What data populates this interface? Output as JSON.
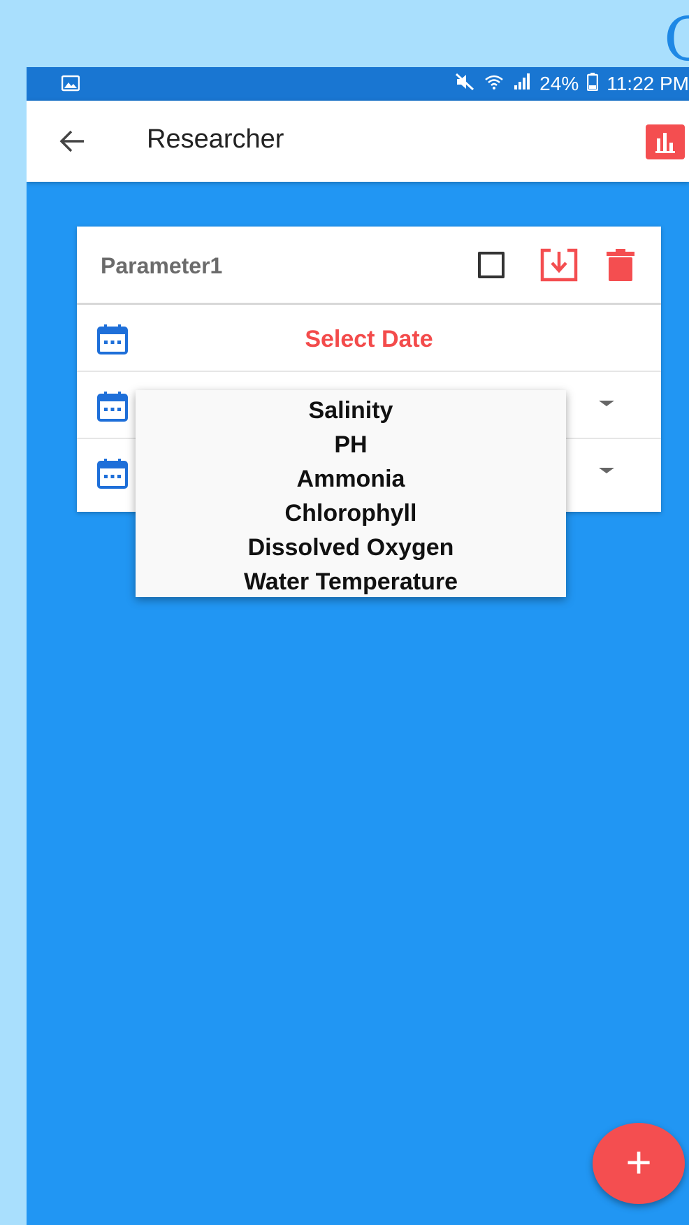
{
  "status_bar": {
    "battery_percent": "24%",
    "time": "11:22 PM",
    "icons": [
      "gallery-icon",
      "mute-icon",
      "wifi-icon",
      "signal-icon",
      "battery-icon"
    ]
  },
  "app_bar": {
    "title": "Researcher",
    "back_icon": "arrow-left-icon",
    "action_icon": "bar-chart-icon"
  },
  "card": {
    "title": "Parameter1",
    "header_icons": [
      "checkbox-icon",
      "download-icon",
      "delete-icon"
    ],
    "rows": [
      {
        "icon": "calendar-icon",
        "label": "Select Date"
      },
      {
        "icon": "calendar-icon",
        "label": ""
      },
      {
        "icon": "calendar-icon",
        "label": ""
      }
    ]
  },
  "dropdown": {
    "options": [
      "Salinity",
      "PH",
      "Ammonia",
      "Chlorophyll",
      "Dissolved Oxygen",
      "Water Temperature"
    ]
  },
  "fab": {
    "label": "+",
    "icon": "plus-icon"
  },
  "colors": {
    "page_background": "#a9dffd",
    "status_bar": "#1976d2",
    "app_background": "#2196f3",
    "accent_red": "#f44e50",
    "calendar_blue": "#1e6fd9"
  }
}
